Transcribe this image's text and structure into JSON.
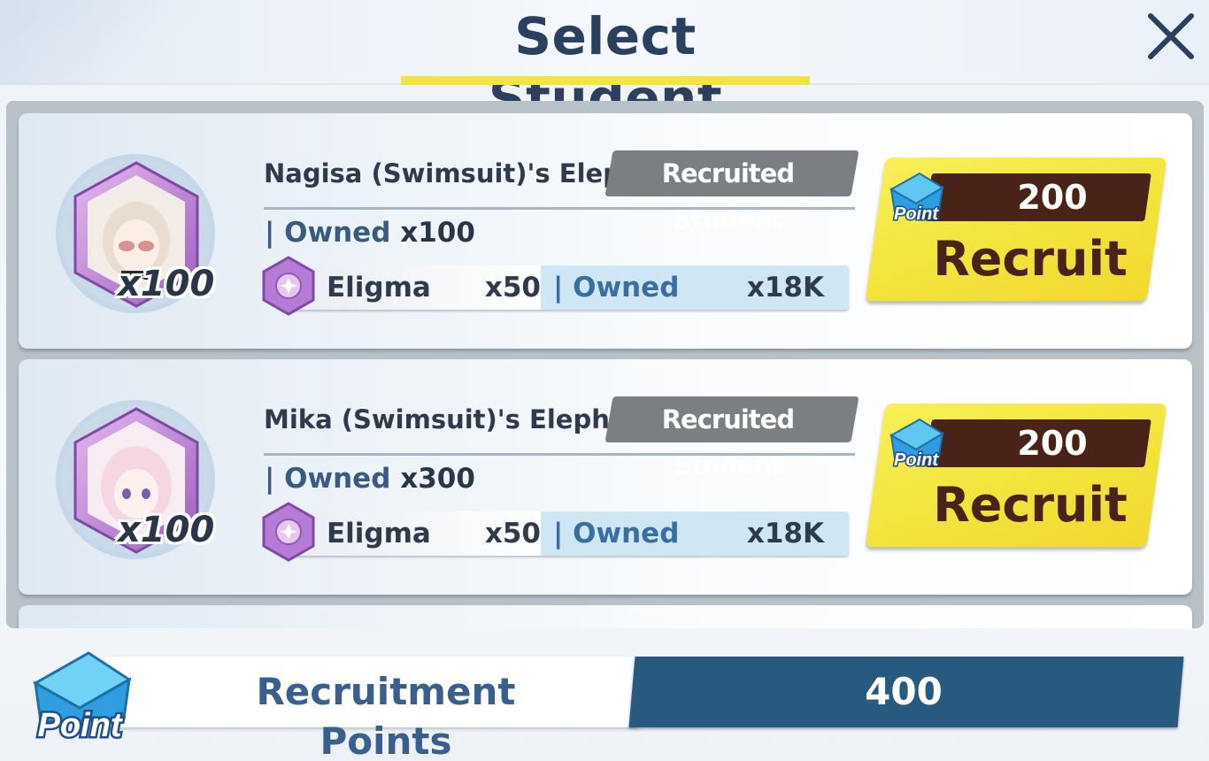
{
  "header": {
    "title": "Select Student",
    "close_icon": "close-icon"
  },
  "students": [
    {
      "name": "Nagisa (Swimsuit)'s Eleph",
      "badge": "Recruited Student",
      "stack_count": "x100",
      "owned_label": "Owned",
      "owned_value": "x100",
      "eligma_label": "Eligma",
      "eligma_amount": "x50",
      "eligma_owned_label": "Owned",
      "eligma_owned_value": "x18K",
      "price": "200",
      "point_label": "Point",
      "recruit_label": "Recruit",
      "portrait_hair": "#e9ddcf"
    },
    {
      "name": "Mika (Swimsuit)'s Eleph",
      "badge": "Recruited Student",
      "stack_count": "x100",
      "owned_label": "Owned",
      "owned_value": "x300",
      "eligma_label": "Eligma",
      "eligma_amount": "x50",
      "eligma_owned_label": "Owned",
      "eligma_owned_value": "x18K",
      "price": "200",
      "point_label": "Point",
      "recruit_label": "Recruit",
      "portrait_hair": "#f6d6e2"
    }
  ],
  "footer": {
    "point_label": "Point",
    "label": "Recruitment Points",
    "value": "400"
  },
  "colors": {
    "title": "#2b3f5e",
    "title_underline": "#f3e541",
    "recruit_button": "#f3e43c",
    "price_bar": "#4a2318",
    "footer_value_bg": "#275a7e"
  }
}
